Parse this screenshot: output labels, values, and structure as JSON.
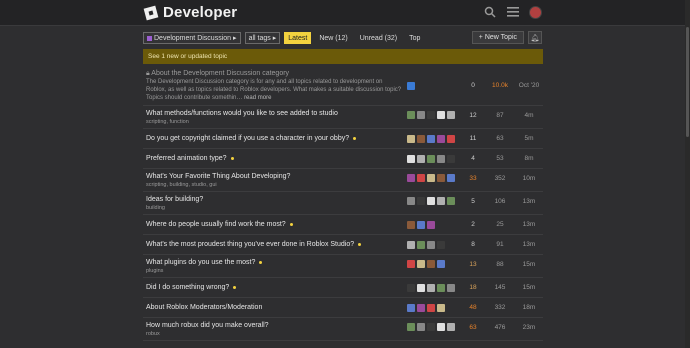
{
  "header": {
    "site_title": "Developer"
  },
  "nav": {
    "category": "Development Discussion",
    "tags": "all tags",
    "tabs": [
      "Latest",
      "New (12)",
      "Unread (32)",
      "Top"
    ],
    "new_topic": "+ New Topic"
  },
  "banner": "See 1 new or updated topic",
  "pinned": {
    "title": "About the Development Discussion category",
    "excerpt": "The Development Discussion category is for any and all topics related to development on Roblox, as well as topics related to Roblox developers. What makes a suitable discussion topic? Topics should contribute somethin…",
    "read_more": "read more",
    "replies": "0",
    "views": "10.0k",
    "activity": "Oct '20"
  },
  "topics": [
    {
      "title": "What methods/functions would you like to see added to studio",
      "tags": "scripting, function",
      "replies": "12",
      "views": "87",
      "activity": "4m",
      "new": false
    },
    {
      "title": "Do you get copyright claimed if you use a character in your obby?",
      "tags": "",
      "replies": "11",
      "views": "63",
      "activity": "5m",
      "new": true
    },
    {
      "title": "Preferred animation type?",
      "tags": "",
      "replies": "4",
      "views": "53",
      "activity": "8m",
      "new": true
    },
    {
      "title": "What's Your Favorite Thing About Developing?",
      "tags": "scripting, building, studio, gui",
      "replies": "33",
      "views": "352",
      "activity": "10m",
      "new": false
    },
    {
      "title": "Ideas for building?",
      "tags": "building",
      "replies": "5",
      "views": "106",
      "activity": "13m",
      "new": false
    },
    {
      "title": "Where do people usually find work the most?",
      "tags": "",
      "replies": "2",
      "views": "25",
      "activity": "13m",
      "new": true
    },
    {
      "title": "What's the most proudest thing you've ever done in Roblox Studio?",
      "tags": "",
      "replies": "8",
      "views": "91",
      "activity": "13m",
      "new": true
    },
    {
      "title": "What plugins do you use the most?",
      "tags": "plugins",
      "replies": "13",
      "views": "88",
      "activity": "15m",
      "new": true
    },
    {
      "title": "Did I do something wrong?",
      "tags": "",
      "replies": "18",
      "views": "145",
      "activity": "15m",
      "new": true
    },
    {
      "title": "About Roblox Moderators/Moderation",
      "tags": "",
      "replies": "48",
      "views": "332",
      "activity": "18m",
      "new": false
    },
    {
      "title": "How much robux did you make overall?",
      "tags": "robux",
      "replies": "63",
      "views": "476",
      "activity": "23m",
      "new": false
    }
  ]
}
